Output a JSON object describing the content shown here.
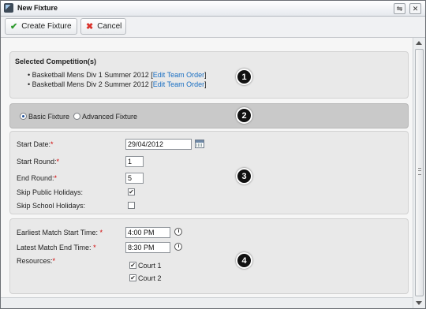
{
  "window": {
    "title": "New Fixture"
  },
  "toolbar": {
    "create_label": "Create Fixture",
    "cancel_label": "Cancel"
  },
  "colors": {
    "accent": "#1a6fc2",
    "required": "#d00000",
    "create_icon": "#2e9a2e",
    "cancel_icon": "#d9322b"
  },
  "section1": {
    "badge": "1",
    "heading": "Selected Competition(s)",
    "competitions": [
      {
        "name": "Basketball Mens Div 1 Summer 2012",
        "link": "Edit Team Order"
      },
      {
        "name": "Basketball Mens Div 2 Summer 2012",
        "link": "Edit Team Order"
      }
    ]
  },
  "section2": {
    "badge": "2",
    "options": [
      {
        "label": "Basic Fixture",
        "selected": true
      },
      {
        "label": "Advanced Fixture",
        "selected": false
      }
    ]
  },
  "section3": {
    "badge": "3",
    "start_date_label": "Start Date:",
    "start_date_value": "29/04/2012",
    "start_round_label": "Start Round:",
    "start_round_value": "1",
    "end_round_label": "End Round:",
    "end_round_value": "5",
    "skip_public_label": "Skip Public Holidays:",
    "skip_public_checked": true,
    "skip_school_label": "Skip School Holidays:",
    "skip_school_checked": false
  },
  "section4": {
    "badge": "4",
    "earliest_label": "Earliest Match Start Time:",
    "earliest_value": "4:00 PM",
    "latest_label": "Latest Match End Time:",
    "latest_value": "8:30 PM",
    "resources_label": "Resources:",
    "resources": [
      {
        "label": "Court 1",
        "checked": true
      },
      {
        "label": "Court 2",
        "checked": true
      }
    ]
  },
  "required_mark": "*",
  "icons": [
    "app-icon",
    "restore-icon",
    "close-icon",
    "check-icon",
    "x-icon",
    "calendar-icon",
    "clock-icon"
  ]
}
